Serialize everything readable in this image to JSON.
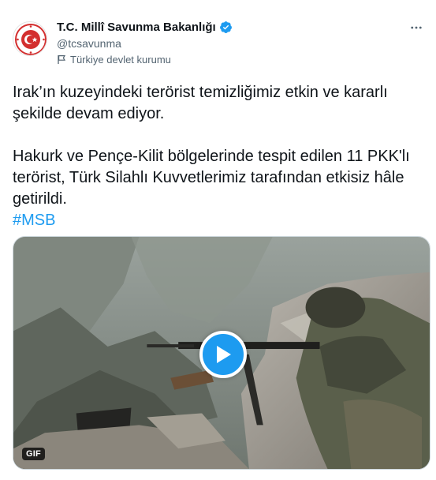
{
  "account": {
    "display_name": "T.C. Millî Savunma Bakanlığı",
    "handle": "@tcsavunma",
    "label": "Türkiye devlet kurumu",
    "verified": true
  },
  "tweet": {
    "paragraph1": "Irak’ın kuzeyindeki terörist temizliğimiz etkin ve kararlı şekilde devam ediyor.",
    "paragraph2": "Hakurk ve Pençe-Kilit bölgelerinde tespit edilen 11 PKK'lı terörist, Türk Silahlı Kuvvetlerimiz tarafından etkisiz hâle getirildi.",
    "hashtag": "#MSB"
  },
  "media": {
    "badge": "GIF"
  },
  "icons": {
    "more": "more-icon",
    "verified": "verified-badge-icon",
    "label": "flag-icon",
    "play": "play-icon"
  },
  "colors": {
    "accent": "#1d9bf0",
    "text": "#0f1419",
    "muted": "#536471"
  }
}
